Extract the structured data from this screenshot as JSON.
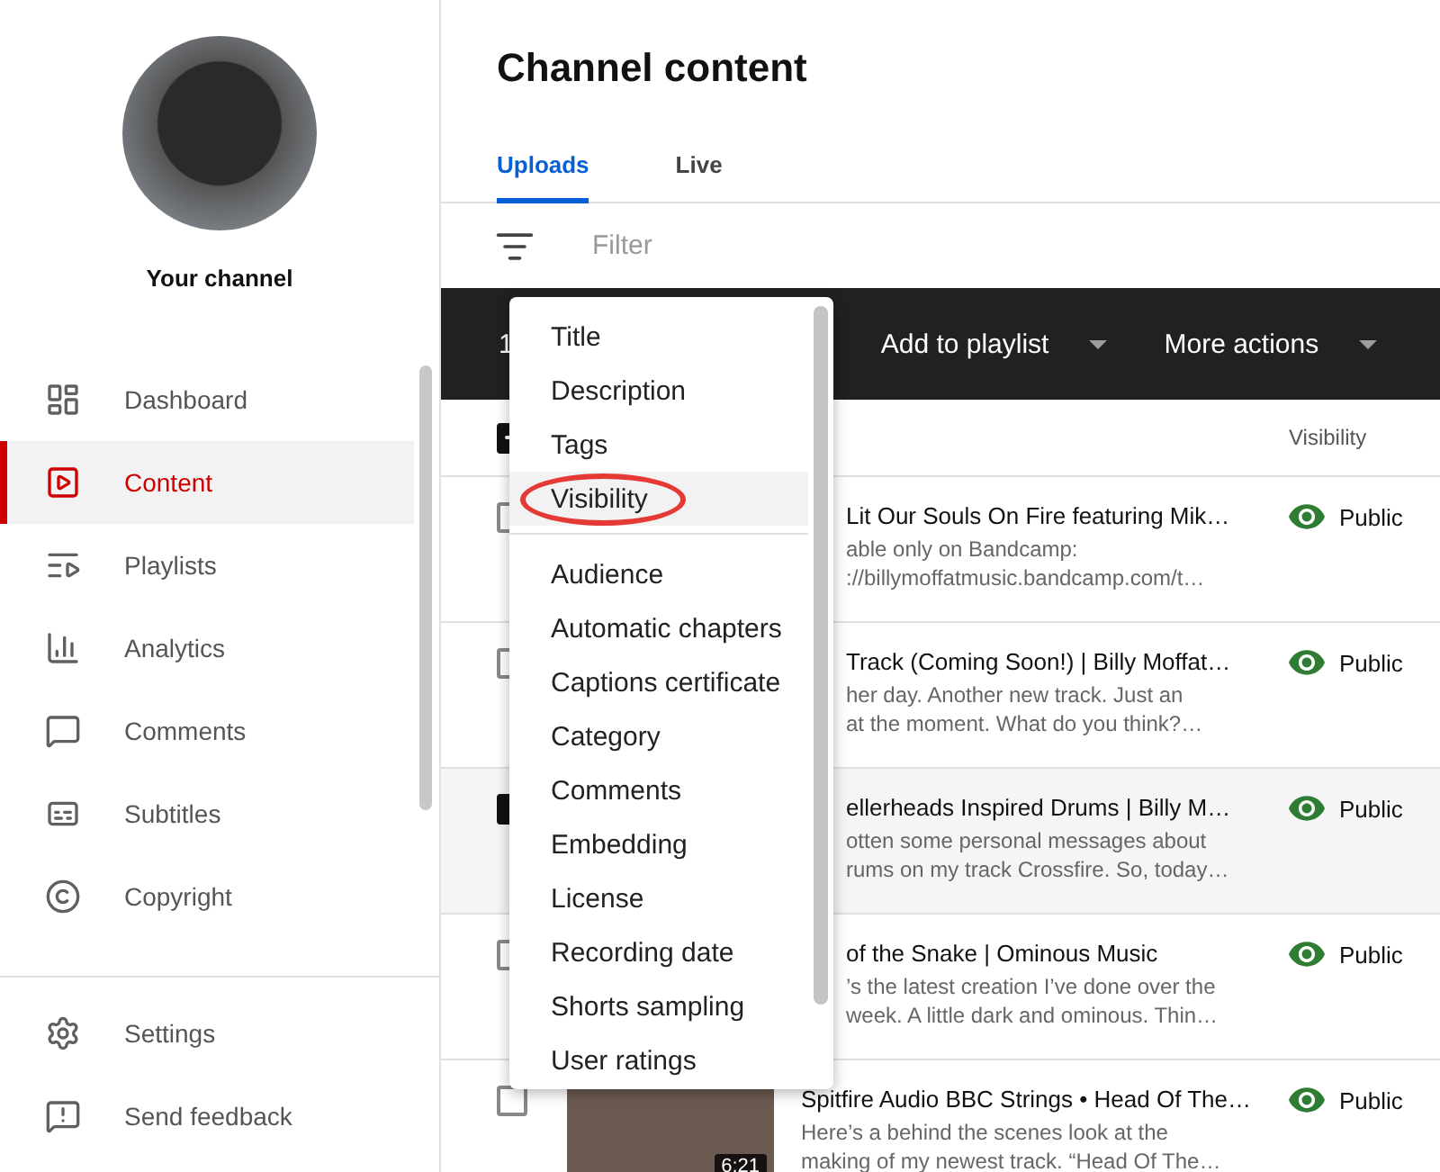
{
  "sidebar": {
    "channel_label": "Your channel",
    "nav": [
      {
        "label": "Dashboard",
        "selected": false
      },
      {
        "label": "Content",
        "selected": true
      },
      {
        "label": "Playlists",
        "selected": false
      },
      {
        "label": "Analytics",
        "selected": false
      },
      {
        "label": "Comments",
        "selected": false
      },
      {
        "label": "Subtitles",
        "selected": false
      },
      {
        "label": "Copyright",
        "selected": false
      }
    ],
    "footer": [
      {
        "label": "Settings"
      },
      {
        "label": "Send feedback"
      }
    ]
  },
  "main": {
    "title": "Channel content",
    "tabs": [
      {
        "label": "Uploads",
        "selected": true
      },
      {
        "label": "Live",
        "selected": false
      }
    ],
    "filter": {
      "placeholder": "Filter"
    },
    "action_bar": {
      "selected_count": "1",
      "actions": [
        {
          "label": "Add to playlist"
        },
        {
          "label": "More actions"
        }
      ]
    },
    "table": {
      "header_checkbox": {
        "indeterminate": true
      },
      "columns": [
        {
          "label": "Visibility"
        }
      ],
      "rows": [
        {
          "checked": false,
          "thumbnail": false,
          "title": "Lit Our Souls On Fire featuring Mik…",
          "description_lines": [
            "able only on Bandcamp:",
            "://billymoffatmusic.bandcamp.com/t…"
          ],
          "visibility": "Public"
        },
        {
          "checked": false,
          "thumbnail": false,
          "title": "Track (Coming Soon!) | Billy Moffat…",
          "description_lines": [
            "her day. Another new track. Just an",
            "at the moment. What do you think?…"
          ],
          "visibility": "Public"
        },
        {
          "checked": true,
          "thumbnail": false,
          "title": "ellerheads Inspired Drums | Billy M…",
          "description_lines": [
            "otten some personal messages about",
            "rums on my track Crossfire. So, today…"
          ],
          "visibility": "Public"
        },
        {
          "checked": false,
          "thumbnail": false,
          "title": "of the Snake | Ominous Music",
          "description_lines": [
            "’s the latest creation I’ve done over the",
            "week. A little dark and ominous. Thin…"
          ],
          "visibility": "Public"
        },
        {
          "checked": false,
          "thumbnail": true,
          "duration": "6:21",
          "title": "Spitfire Audio BBC Strings • Head Of The…",
          "description_lines": [
            "Here’s a behind the scenes look at the",
            "making of my newest track. “Head Of The…"
          ],
          "visibility": "Public"
        }
      ]
    }
  },
  "menu": {
    "groups": [
      [
        {
          "label": "Title",
          "highlighted": false,
          "circled": false
        },
        {
          "label": "Description",
          "highlighted": false,
          "circled": false
        },
        {
          "label": "Tags",
          "highlighted": false,
          "circled": false
        },
        {
          "label": "Visibility",
          "highlighted": true,
          "circled": true
        }
      ],
      [
        {
          "label": "Audience",
          "highlighted": false,
          "circled": false
        },
        {
          "label": "Automatic chapters",
          "highlighted": false,
          "circled": false
        },
        {
          "label": "Captions certificate",
          "highlighted": false,
          "circled": false
        },
        {
          "label": "Category",
          "highlighted": false,
          "circled": false
        },
        {
          "label": "Comments",
          "highlighted": false,
          "circled": false
        },
        {
          "label": "Embedding",
          "highlighted": false,
          "circled": false
        },
        {
          "label": "License",
          "highlighted": false,
          "circled": false
        },
        {
          "label": "Recording date",
          "highlighted": false,
          "circled": false
        },
        {
          "label": "Shorts sampling",
          "highlighted": false,
          "circled": false
        },
        {
          "label": "User ratings",
          "highlighted": false,
          "circled": false
        }
      ]
    ]
  }
}
